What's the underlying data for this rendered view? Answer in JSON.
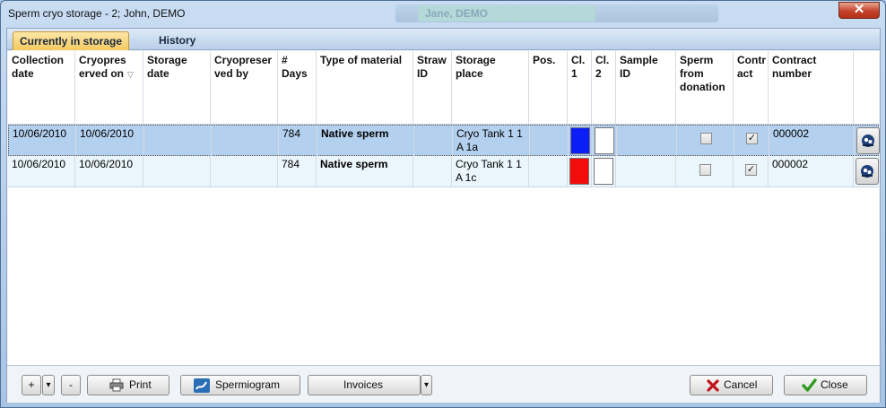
{
  "window": {
    "title": "Sperm cryo storage - 2; John, DEMO",
    "background_patient": "Jane, DEMO",
    "close_glyph": "✕"
  },
  "tabs": [
    {
      "label": "Currently in storage",
      "active": true
    },
    {
      "label": "History",
      "active": false
    }
  ],
  "columns": [
    {
      "key": "collection_date",
      "label": "Collection date"
    },
    {
      "key": "cryopreserved_on",
      "label": "Cryopres erved on",
      "sorted": true,
      "sort_icon": "▽"
    },
    {
      "key": "storage_date",
      "label": "Storage date"
    },
    {
      "key": "cryopreserved_by",
      "label": "Cryopreser ved by"
    },
    {
      "key": "days",
      "label": "# Days"
    },
    {
      "key": "type_of_material",
      "label": "Type of material"
    },
    {
      "key": "straw_id",
      "label": "Straw ID"
    },
    {
      "key": "storage_place",
      "label": "Storage place"
    },
    {
      "key": "pos",
      "label": "Pos."
    },
    {
      "key": "cl1",
      "label": "Cl. 1"
    },
    {
      "key": "cl2",
      "label": "Cl. 2"
    },
    {
      "key": "sample_id",
      "label": "Sample ID"
    },
    {
      "key": "sperm_from_donation",
      "label": "Sperm from donation"
    },
    {
      "key": "contract",
      "label": "Contr act"
    },
    {
      "key": "contract_number",
      "label": "Contract number"
    }
  ],
  "rows": [
    {
      "collection_date": "10/06/2010",
      "cryopreserved_on": "10/06/2010",
      "storage_date": "",
      "cryopreserved_by": "",
      "days": "784",
      "type_of_material": "Native sperm",
      "straw_id": "",
      "storage_place": "Cryo Tank 1 1 A 1a",
      "pos": "",
      "cl1_color": "#0a1ef5",
      "cl2_color": "#ffffff",
      "sample_id": "",
      "sperm_from_donation": false,
      "contract": true,
      "contract_number": "000002",
      "selected": true
    },
    {
      "collection_date": "10/06/2010",
      "cryopreserved_on": "10/06/2010",
      "storage_date": "",
      "cryopreserved_by": "",
      "days": "784",
      "type_of_material": "Native sperm",
      "straw_id": "",
      "storage_place": "Cryo Tank 1 1 A 1c",
      "pos": "",
      "cl1_color": "#f40c0c",
      "cl2_color": "#ffffff",
      "sample_id": "",
      "sperm_from_donation": false,
      "contract": true,
      "contract_number": "000002",
      "selected": false
    }
  ],
  "footer": {
    "add_label": "+",
    "dropdown_glyph": "▾",
    "remove_label": "-",
    "print_label": "Print",
    "spermiogram_label": "Spermiogram",
    "invoices_label": "Invoices",
    "cancel_label": "Cancel",
    "close_label": "Close"
  },
  "colors": {
    "selected_row": "#b4d0ef",
    "alt_row": "#eaf5fc",
    "active_tab": "#f4c95e",
    "cancel_icon": "#c0141a",
    "close_icon": "#2f9a1f"
  }
}
